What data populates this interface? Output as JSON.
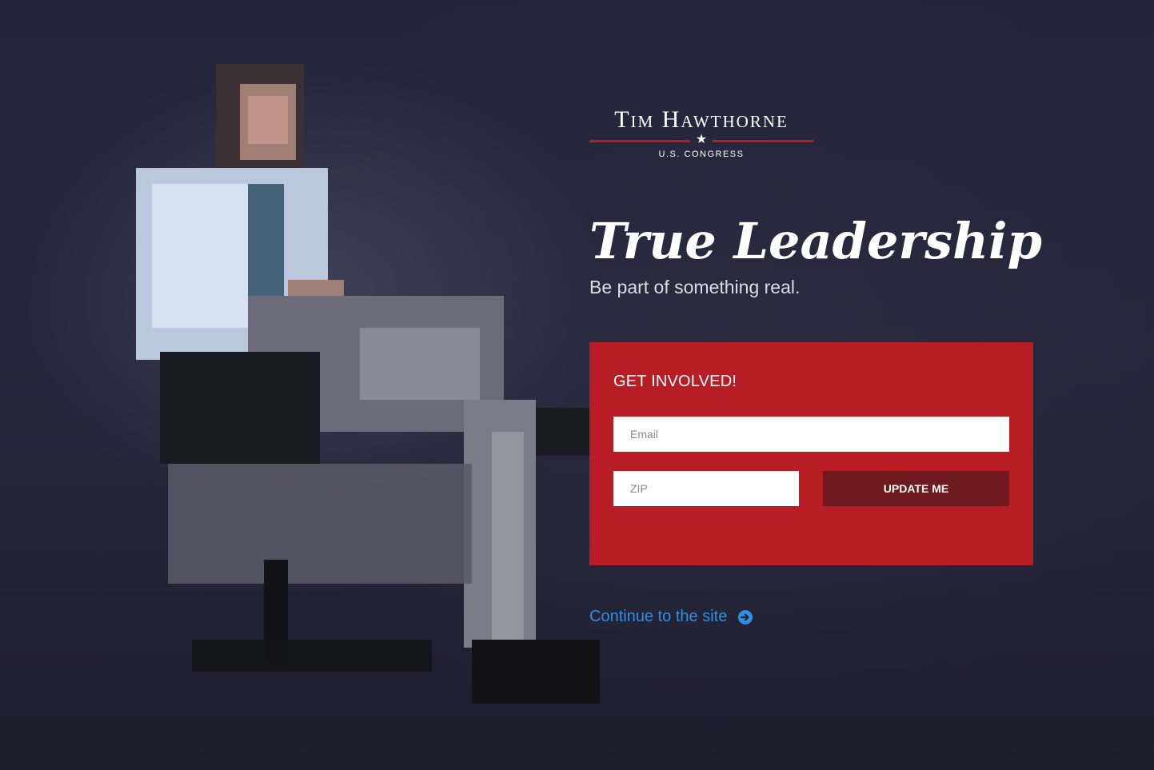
{
  "logo": {
    "name": "Tim Hawthorne",
    "subtitle": "U.S. CONGRESS",
    "star": "★"
  },
  "hero": {
    "headline": "True Leadership",
    "tagline": "Be part of something real."
  },
  "signup": {
    "title": "GET INVOLVED!",
    "email_placeholder": "Email",
    "zip_placeholder": "ZIP",
    "submit_label": "UPDATE ME"
  },
  "continue_link": {
    "label": "Continue to the site",
    "icon": "arrow-circle-right-icon"
  },
  "colors": {
    "brand_red": "#b81d26",
    "button_dark_red": "#6e1a1f",
    "link_blue": "#2f8fe0",
    "background_navy": "#23243a"
  }
}
